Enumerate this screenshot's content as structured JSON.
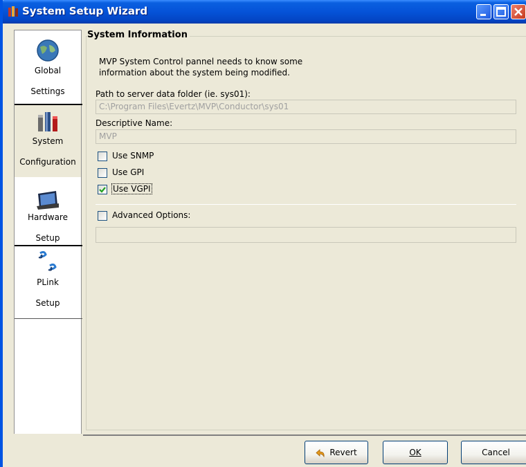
{
  "window": {
    "title": "System Setup Wizard",
    "accent": "#0054e3"
  },
  "sidebar": {
    "items": [
      {
        "line1": "Global",
        "line2": "Settings",
        "icon": "globe-icon"
      },
      {
        "line1": "System",
        "line2": "Configuration",
        "icon": "tools-icon"
      },
      {
        "line1": "Hardware",
        "line2": "Setup",
        "icon": "monitor-icon"
      },
      {
        "line1": "PLink",
        "line2": "Setup",
        "icon": "link-icon"
      }
    ]
  },
  "main": {
    "group_title": "System Information",
    "description_line1": "MVP System Control pannel needs to know some",
    "description_line2": "information about the system being modified.",
    "path_label": "Path to server data folder (ie. sys01):",
    "path_value": "C:\\Program Files\\Evertz\\MVP\\Conductor\\sys01",
    "name_label": "Descriptive Name:",
    "name_value": "MVP",
    "checkboxes": [
      {
        "label": "Use SNMP",
        "checked": false
      },
      {
        "label": "Use GPI",
        "checked": false
      },
      {
        "label": "Use VGPI",
        "checked": true
      }
    ],
    "advanced_label": "Advanced Options:",
    "advanced_checked": false,
    "advanced_value": ""
  },
  "buttons": {
    "revert": "Revert",
    "ok": "OK",
    "cancel": "Cancel"
  }
}
